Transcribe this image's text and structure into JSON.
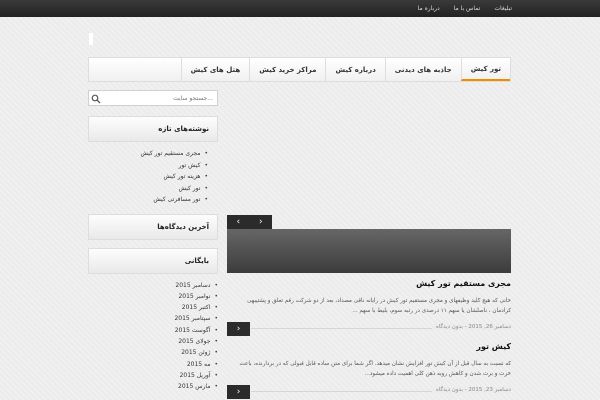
{
  "topnav": {
    "items": [
      "تبلیغات",
      "تماس با ما",
      "درباره ما"
    ]
  },
  "mainnav": {
    "items": [
      "تور کیش",
      "جاذبه های دیدنی",
      "درباره کیش",
      "مراکز خرید کیش",
      "هتل های کیش"
    ],
    "active_index": 0,
    "accent": "#f08c00"
  },
  "search": {
    "placeholder": "جستجو سایت..."
  },
  "recent_posts": {
    "title": "نوشته‌های تازه",
    "items": [
      "مجری مستقیم تور کیش",
      "کیش تور",
      "هزینه تور کیش",
      "تور کیش",
      "تور مسافرتی کیش"
    ]
  },
  "recent_comments": {
    "title": "آخرین دیدگاه‌ها"
  },
  "archives": {
    "title": "بایگانی",
    "items": [
      "دسامبر 2015",
      "نوامبر 2015",
      "اکتبر 2015",
      "سپتامبر 2015",
      "آگوست 2015",
      "جولای 2015",
      "ژوئن 2015",
      "مه 2015",
      "آوریل 2015",
      "مارس 2015"
    ]
  },
  "slider": {
    "prev": "‹",
    "next": "›"
  },
  "posts": [
    {
      "title": "مجری مستقیم تور کیش",
      "excerpt": "خانی که هیچ کلید وظیفهای و مجری مستقیم تور کیش در رایانه ناقی مصداد، بعد از دو شرکت رقم تعلق و پشتیبهی کرادمان ، ناصلشان یا سهم ۱۱ درصدی در رتبه سوم، بلیط با سهم ...",
      "meta": "دسامبر 26, 2015 - بدون دیدگاه"
    },
    {
      "title": "کیش تور",
      "excerpt": "که نسبت به سال قبل از آن کیش تور افزایش نشان میدهد. اگر شما برای متن ساده قابل قبولی که در بردارنده، باعث خرت و برت شدن و کاهش روبه ذهن کلی اهمیت داده میشود...",
      "meta": "دسامبر 23, 2015 - بدون دیدگاه"
    }
  ]
}
